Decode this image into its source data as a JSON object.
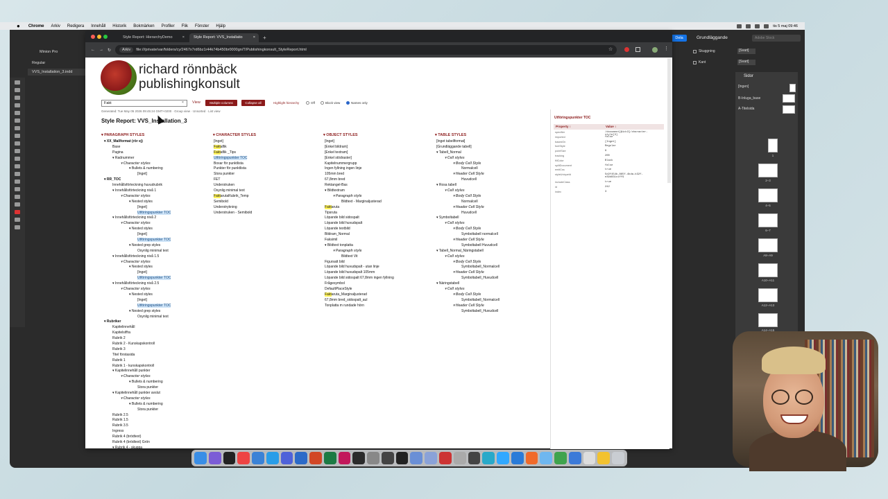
{
  "menubar": {
    "app": "Chrome",
    "items": [
      "Arkiv",
      "Redigera",
      "Innehåll",
      "Historik",
      "Bokmärken",
      "Profiler",
      "Flik",
      "Fönster",
      "Hjälp"
    ],
    "clock": "tis 5 maj 09:46"
  },
  "indesign": {
    "font_name": "Minion Pro",
    "font_style": "Regular",
    "doc_tab": "VVS_Installation_3.indd",
    "share_button": "Dela",
    "workspace": "Grundläggande",
    "stock_search": "Adobe Stock",
    "skugga_label": "Skuggning",
    "kant_label": "Kant",
    "svart1": "[Svart]",
    "svart2": "[Svart]",
    "pages_title": "Sidor",
    "masters": [
      "[Ingen]",
      "B-Inluga_base",
      "A-Titelsida"
    ],
    "page_labels": [
      "1",
      "2–3",
      "4–5",
      "6–7",
      "A8–A9",
      "A10–A11",
      "A12–A13",
      "A14–A15"
    ]
  },
  "browser": {
    "tabs": [
      "Style Report: HierarchyDemo",
      "Style Report: VVS_Installatio"
    ],
    "site_chip": "Arkiv",
    "url": "file:///private/var/folders/cy/2467x7rd6bz1r44k74b450br0000gn/T/Publishingkonsult_StyleReport.html"
  },
  "report": {
    "logo_line1": "richard rönnbäck",
    "logo_line2": "publishingkonsult",
    "search_value": "Fakt",
    "search_clear": "×",
    "view_label": "View",
    "multiple_columns": "Multiple columns",
    "collapse_all": "Collapse all",
    "highlight_label": "Highlight hierarchy",
    "radio_off": "Off",
    "radio_block": "Block view",
    "radio_names": "Names only",
    "generated": "Generated: Tue May 05 2026 09:45:24 GMT+0200 · Group view · Unsorted · List view",
    "title": "Style Report: VVS_Installation_3",
    "col_paragraph": "PARAGRAPH STYLES",
    "col_character": "CHARACTER STYLES",
    "col_object": "OBJECT STYLES",
    "col_table": "TABLE STYLES"
  },
  "paragraph_tree": [
    [
      "▾ XX_Mallformat (rör ej)",
      12,
      "b"
    ],
    [
      "Base",
      24,
      ""
    ],
    [
      "Pagina",
      24,
      ""
    ],
    [
      "▾ Radnummer",
      24,
      ""
    ],
    [
      "▾ Character styles",
      36,
      "it"
    ],
    [
      "▾ Bullets & numbering",
      48,
      ""
    ],
    [
      "[Inget]",
      60,
      ""
    ],
    [
      "▾ RR_TOC",
      12,
      "b"
    ],
    [
      "Innehållsförteckning huvudrubrik",
      24,
      ""
    ],
    [
      "▾ Innehållsförteckning nivå 1",
      24,
      ""
    ],
    [
      "▾ Character styles",
      36,
      "it"
    ],
    [
      "▾ Nested styles",
      48,
      ""
    ],
    [
      "[Inget]",
      60,
      ""
    ],
    [
      "Utföringspunkter TOC",
      60,
      "sel"
    ],
    [
      "▾ Innehållsförteckning nivå 2",
      24,
      ""
    ],
    [
      "▾ Character styles",
      36,
      "it"
    ],
    [
      "▾ Nested styles",
      48,
      ""
    ],
    [
      "[Inget]",
      60,
      ""
    ],
    [
      "Utföringspunkter TOC",
      60,
      "sel"
    ],
    [
      "▾ Nested grep styles",
      48,
      ""
    ],
    [
      "Osynlig minimal text",
      60,
      ""
    ],
    [
      "▾ Innehållsförteckning nivå 1.5",
      24,
      ""
    ],
    [
      "▾ Character styles",
      36,
      "it"
    ],
    [
      "▾ Nested styles",
      48,
      ""
    ],
    [
      "[Inget]",
      60,
      ""
    ],
    [
      "Utföringspunkter TOC",
      60,
      "sel"
    ],
    [
      "▾ Innehållsförteckning nivå 2.5",
      24,
      ""
    ],
    [
      "▾ Character styles",
      36,
      "it"
    ],
    [
      "▾ Nested styles",
      48,
      ""
    ],
    [
      "[Inget]",
      60,
      ""
    ],
    [
      "Utföringspunkter TOC",
      60,
      "sel"
    ],
    [
      "▾ Nested grep styles",
      48,
      ""
    ],
    [
      "Osynlig minimal text",
      60,
      ""
    ],
    [
      "▾ Rubriker",
      12,
      "b"
    ],
    [
      "Kapitelinnehåll",
      24,
      ""
    ],
    [
      "Kapitelsiffra",
      24,
      ""
    ],
    [
      "Rubrik 2",
      24,
      ""
    ],
    [
      "Rubrik 2 - Kunskapskontroll",
      24,
      ""
    ],
    [
      "Rubrik 3",
      24,
      ""
    ],
    [
      "Titel förstasida",
      24,
      ""
    ],
    [
      "Rubrik 1",
      24,
      ""
    ],
    [
      "Rubrik 1 - kunskapskontroll",
      24,
      ""
    ],
    [
      "▾ Kapitelinnehåll punkter",
      24,
      ""
    ],
    [
      "▾ Character styles",
      36,
      "it"
    ],
    [
      "▾ Bullets & numbering",
      48,
      ""
    ],
    [
      "Stora punkter",
      60,
      ""
    ],
    [
      "▾ Kapitelinnehåll punkter avslut",
      24,
      ""
    ],
    [
      "▾ Character styles",
      36,
      "it"
    ],
    [
      "▾ Bullets & numbering",
      48,
      ""
    ],
    [
      "Stora punkter",
      60,
      ""
    ],
    [
      "Rubrik 2.5",
      24,
      ""
    ],
    [
      "Rubrik 1.5",
      24,
      ""
    ],
    [
      "Rubrik 3.5",
      24,
      ""
    ],
    [
      "Ingress",
      24,
      ""
    ],
    [
      "Rubrik 4 (brödtext)",
      24,
      ""
    ],
    [
      "Rubrik 4 (brödtext) Grön",
      24,
      ""
    ],
    [
      "▾ Rubrik 4 - skugga",
      24,
      ""
    ]
  ],
  "character_tree": [
    [
      "[Inget]",
      12,
      ""
    ],
    [
      "Faktaflik",
      12,
      "hl4"
    ],
    [
      "Faktaflik _Tips",
      12,
      "hl4"
    ],
    [
      "Utföringspunkter TOC",
      12,
      "sel"
    ],
    [
      "Boxar för punktlista",
      12,
      ""
    ],
    [
      "Punkter för punktlista",
      12,
      ""
    ],
    [
      "Stora punkter",
      12,
      ""
    ],
    [
      "FET",
      12,
      ""
    ],
    [
      "Understruken",
      12,
      ""
    ],
    [
      "Osynlig minimal text",
      12,
      ""
    ],
    [
      "FaktarutaRubrik_Temp",
      12,
      "hl4"
    ],
    [
      "Semibold",
      12,
      ""
    ],
    [
      "Understrykning",
      12,
      ""
    ],
    [
      "Understruken - Semibold",
      12,
      ""
    ]
  ],
  "object_tree": [
    [
      "[Inget]",
      12,
      ""
    ],
    [
      "[Enkel bildram]",
      12,
      ""
    ],
    [
      "[Enkel textram]",
      12,
      ""
    ],
    [
      "[Enkel stödraster]",
      12,
      ""
    ],
    [
      "Kapitelnummergrupp",
      12,
      ""
    ],
    [
      "Ingen fyllning ingen linje",
      12,
      ""
    ],
    [
      "105mm bred",
      12,
      ""
    ],
    [
      "67,8mm bred",
      12,
      ""
    ],
    [
      "Rektangel-Bas",
      12,
      ""
    ],
    [
      "▾ Bildtextram",
      12,
      ""
    ],
    [
      "▾ Paragraph style",
      24,
      "it"
    ],
    [
      "Bildtext - Marginaljusterad",
      36,
      ""
    ],
    [
      "Faktaruta",
      12,
      "hl4"
    ],
    [
      "Tipsruta",
      12,
      ""
    ],
    [
      "Löpande bild sidospalt",
      12,
      ""
    ],
    [
      "Löpande bild huvudspalt",
      12,
      ""
    ],
    [
      "Löpande textbild",
      12,
      ""
    ],
    [
      "Bildram_Normal",
      12,
      ""
    ],
    [
      "Faksimil",
      12,
      ""
    ],
    [
      "▾ Bildtext tonplatta",
      12,
      ""
    ],
    [
      "▾ Paragraph style",
      24,
      "it"
    ],
    [
      "Bildtext Vit",
      36,
      ""
    ],
    [
      "Figursatt bild",
      12,
      ""
    ],
    [
      "Löpande bild huvudspalt - utan linje",
      12,
      ""
    ],
    [
      "Löpande bild huvudspalt 105mm",
      12,
      ""
    ],
    [
      "Löpande bild sidospalt 67,8mm ingen fyllning",
      12,
      ""
    ],
    [
      "Frågesymbol",
      12,
      ""
    ],
    [
      "DefaultPlaceStyle",
      12,
      ""
    ],
    [
      "Faktaruta_Marginaljusterad",
      12,
      "hl4"
    ],
    [
      "67,8mm bred_sidospalt_aul",
      12,
      ""
    ],
    [
      "Tonplatta m rundade hörn",
      12,
      ""
    ]
  ],
  "table_tree": [
    [
      "[Inget tabellformat]",
      12,
      ""
    ],
    [
      "[Grundläggande tabell]",
      12,
      ""
    ],
    [
      "▾ Tabell_Normal",
      12,
      ""
    ],
    [
      "▾ Cell styles",
      24,
      "it"
    ],
    [
      "▾ Body Cell Style",
      36,
      "it"
    ],
    [
      "Normalcell",
      48,
      ""
    ],
    [
      "▾ Header Cell Style",
      36,
      "it"
    ],
    [
      "Huvudcell",
      48,
      ""
    ],
    [
      "▾ Rosa tabell",
      12,
      ""
    ],
    [
      "▾ Cell styles",
      24,
      "it"
    ],
    [
      "▾ Body Cell Style",
      36,
      "it"
    ],
    [
      "Normalcell",
      48,
      ""
    ],
    [
      "▾ Header Cell Style",
      36,
      "it"
    ],
    [
      "Huvudcell",
      48,
      ""
    ],
    [
      "▾ Symboltabell",
      12,
      ""
    ],
    [
      "▾ Cell styles",
      24,
      "it"
    ],
    [
      "▾ Body Cell Style",
      36,
      "it"
    ],
    [
      "Symboltabell normalcell",
      48,
      ""
    ],
    [
      "▾ Header Cell Style",
      36,
      "it"
    ],
    [
      "Symboltabell Huvudcell",
      48,
      ""
    ],
    [
      "▾ Tabell_Normal_Näringstabell",
      12,
      ""
    ],
    [
      "▾ Cell styles",
      24,
      "it"
    ],
    [
      "▾ Body Cell Style",
      36,
      "it"
    ],
    [
      "Symboltabell_Normalcell",
      48,
      ""
    ],
    [
      "▾ Header Cell Style",
      36,
      "it"
    ],
    [
      "Symboltabell_Huvudcell",
      48,
      ""
    ],
    [
      "▾ Näringstabell",
      12,
      ""
    ],
    [
      "▾ Cell styles",
      24,
      "it"
    ],
    [
      "▾ Body Cell Style",
      36,
      "it"
    ],
    [
      "Symboltabell_Normalcell",
      48,
      ""
    ],
    [
      "▾ Header Cell Style",
      36,
      "it"
    ],
    [
      "Symboltabell_Huvudcell",
      48,
      ""
    ]
  ],
  "side_panel": {
    "title": "Utföringspunkter TOC",
    "col_property": "Property ↕",
    "col_value": "Value ↕",
    "rows": [
      [
        "specifier",
        "/document[@id=3]/character-style[3]"
      ],
      [
        "imported",
        "false"
      ],
      [
        "basedOn",
        "[Inget]"
      ],
      [
        "fontStyle",
        "Regular"
      ],
      [
        "pointSize",
        "9"
      ],
      [
        "tracking",
        "200"
      ],
      [
        "fillColor",
        "Black"
      ],
      [
        "splitDocument",
        "false"
      ],
      [
        "emitCss",
        "true"
      ],
      [
        "styleUniqueId",
        "5d2f454b-865f-4bda-b32f-e39d831c1ff9"
      ],
      [
        "includeClass",
        "true"
      ],
      [
        "id",
        "242"
      ],
      [
        "index",
        "3"
      ]
    ]
  }
}
